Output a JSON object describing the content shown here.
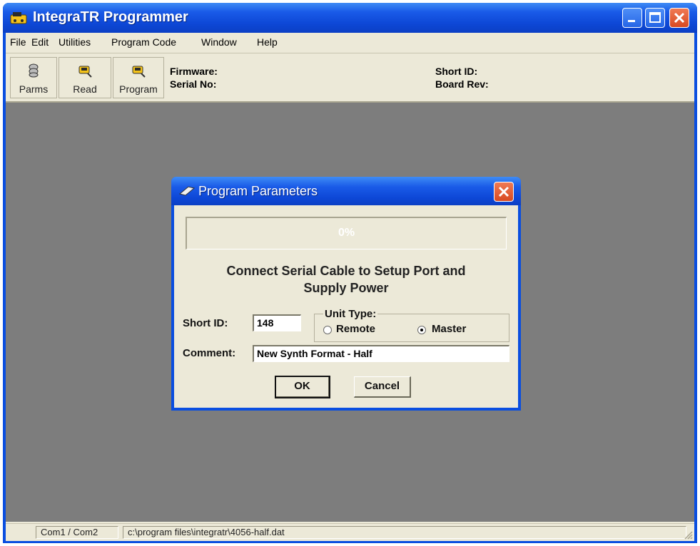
{
  "window": {
    "title": "IntegraTR Programmer",
    "icon": "app-icon"
  },
  "menu": [
    "File",
    "Edit",
    "Utilities",
    "Program Code",
    "Window",
    "Help"
  ],
  "toolbar": {
    "parms_label": "Parms",
    "read_label": "Read",
    "program_label": "Program"
  },
  "info": {
    "firmware_label": "Firmware:",
    "serial_label": "Serial No:",
    "shortid_label": "Short ID:",
    "boardrev_label": "Board Rev:"
  },
  "dialog": {
    "title": "Program Parameters",
    "progress_text": "0%",
    "progress_value": 0,
    "message_line1": "Connect Serial Cable to Setup Port and",
    "message_line2": "Supply Power",
    "short_id_label": "Short ID:",
    "short_id_value": "148",
    "unit_type_label": "Unit Type:",
    "remote_label": "Remote",
    "master_label": "Master",
    "unit_type_selected": "Master",
    "comment_label": "Comment:",
    "comment_value": "New Synth Format - Half",
    "ok_label": "OK",
    "cancel_label": "Cancel"
  },
  "status": {
    "ports": "Com1 / Com2",
    "file_path": "c:\\program files\\integratr\\4056-half.dat"
  },
  "colors": {
    "title_blue": "#0d47d6",
    "workspace": "#7d7d7d",
    "face": "#ece9d8",
    "close_red": "#d84a21"
  }
}
